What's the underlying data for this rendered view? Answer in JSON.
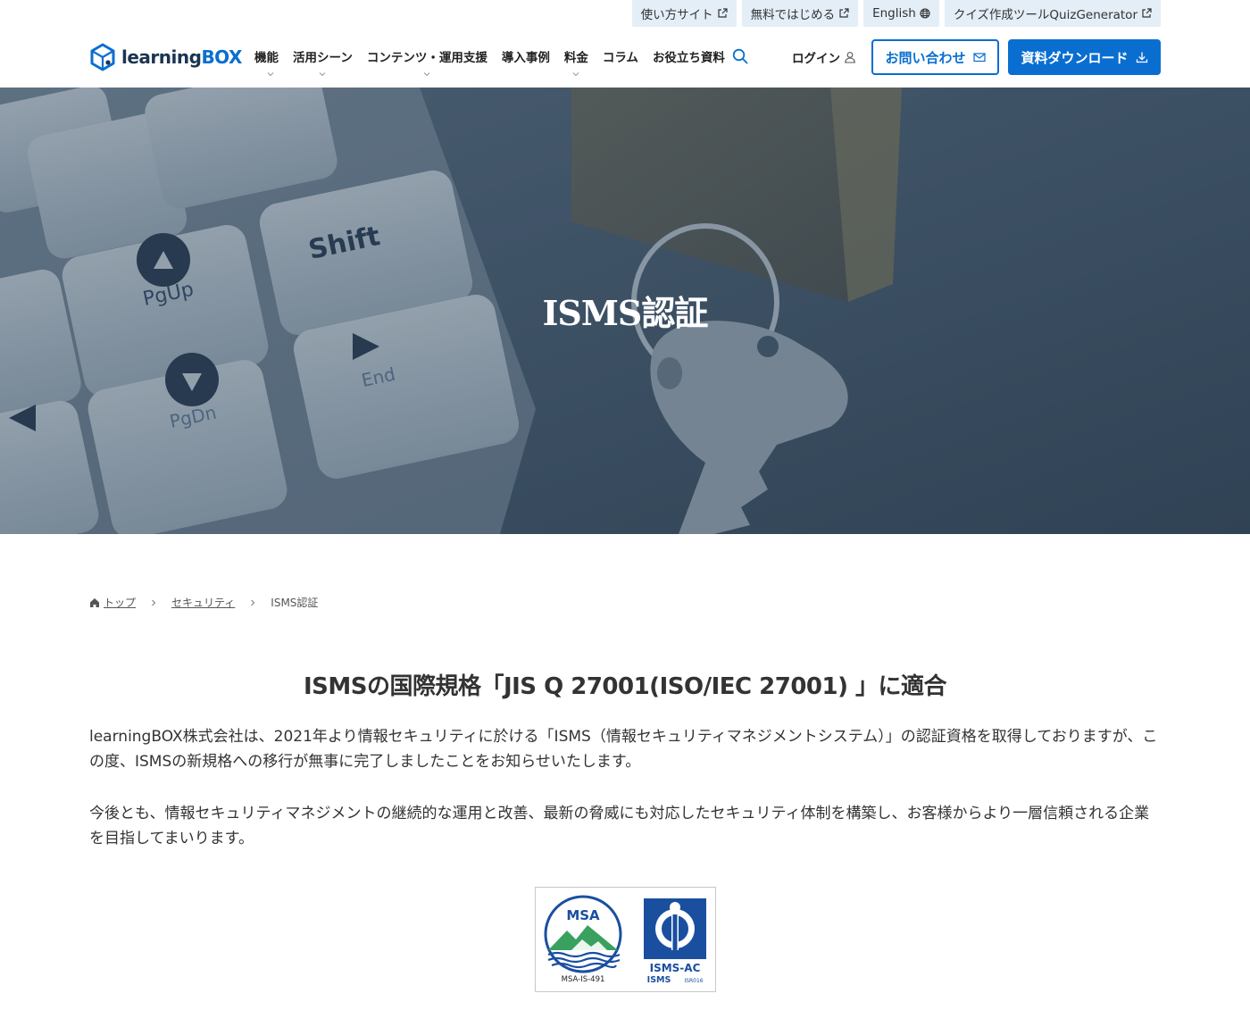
{
  "utility_links": [
    {
      "label": "使い方サイト"
    },
    {
      "label": "無料ではじめる"
    },
    {
      "label": "English"
    },
    {
      "label": "クイズ作成ツールQuizGenerator"
    }
  ],
  "logo": {
    "text_main": "learning",
    "text_box": "BOX"
  },
  "nav": {
    "items": [
      {
        "label": "機能",
        "has_dropdown": true
      },
      {
        "label": "活用シーン",
        "has_dropdown": true
      },
      {
        "label": "コンテンツ・運用支援",
        "has_dropdown": true
      },
      {
        "label": "導入事例",
        "has_dropdown": false
      },
      {
        "label": "料金",
        "has_dropdown": true
      },
      {
        "label": "コラム",
        "has_dropdown": false
      },
      {
        "label": "お役立ち資料",
        "has_dropdown": false
      }
    ],
    "login_label": "ログイン",
    "contact_label": "お問い合わせ",
    "download_label": "資料ダウンロード"
  },
  "hero": {
    "title": "ISMS認証",
    "key_labels": [
      "PgUp",
      "Shift",
      "PgDn",
      "End"
    ]
  },
  "breadcrumb": {
    "home": "トップ",
    "parent": "セキュリティ",
    "current": "ISMS認証"
  },
  "content": {
    "heading": "ISMSの国際規格「JIS Q 27001(ISO/IEC 27001) 」に適合",
    "paragraph1": "learningBOX株式会社は、2021年より情報セキュリティに於ける「ISMS（情報セキュリティマネジメントシステム）」の認証資格を取得しておりますが、この度、ISMSの新規格への移行が無事に完了しましたことをお知らせいたします。",
    "paragraph2": "今後とも、情報セキュリティマネジメントの継続的な運用と改善、最新の脅威にも対応したセキュリティ体制を構築し、お客様からより一層信頼される企業を目指してまいります。"
  },
  "certification": {
    "msa_label": "MSA",
    "msa_code": "MSA-IS-491",
    "isms_ac_label": "ISMS-AC",
    "isms_label": "ISMS",
    "isms_code": "ISR016"
  },
  "colors": {
    "brand_blue": "#0a6ed1",
    "util_bg": "#e4eef7",
    "hero_overlay": "#3d5266",
    "msa_green": "#3aa060",
    "isms_blue": "#1a4fa0"
  }
}
